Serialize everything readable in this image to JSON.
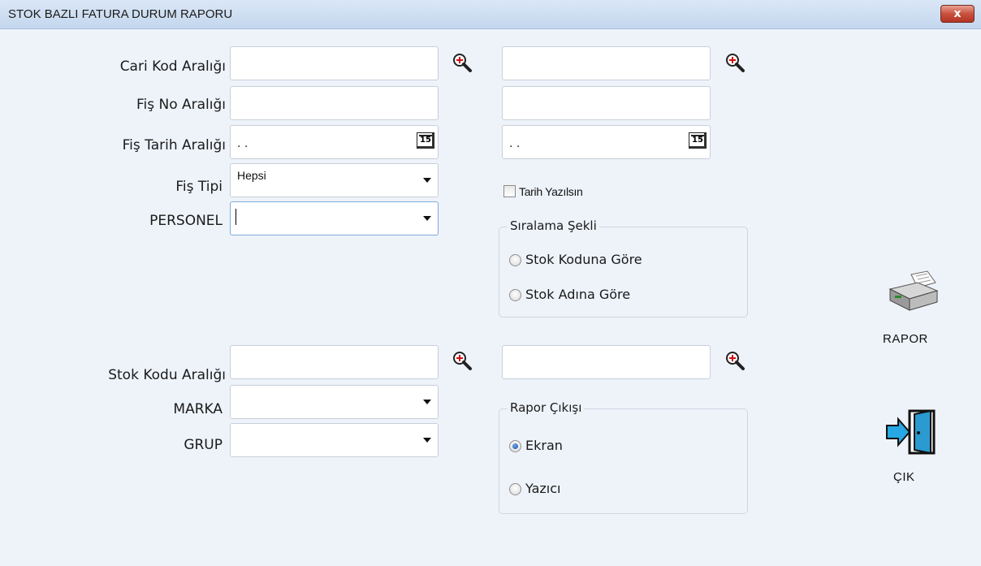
{
  "window": {
    "title": "STOK BAZLI FATURA DURUM RAPORU",
    "close_label": "x"
  },
  "form": {
    "cari_kod_label": "Cari Kod Aralığı",
    "fis_no_label": "Fiş No Aralığı",
    "fis_tarih_label": "Fiş Tarih Aralığı",
    "fis_tipi_label": "Fiş Tipi",
    "personel_label": "PERSONEL",
    "stok_kodu_label": "Stok Kodu Aralığı",
    "marka_label": "MARKA",
    "grup_label": "GRUP",
    "cari_kod_start": "",
    "cari_kod_end": "",
    "fis_no_start": "",
    "fis_no_end": "",
    "fis_tarih_start": ". .",
    "fis_tarih_end": ". .",
    "calendar_icon_text": "15",
    "fis_tipi_value": "Hepsi",
    "personel_value": "",
    "stok_kodu_start": "",
    "stok_kodu_end": "",
    "marka_value": "",
    "grup_value": ""
  },
  "options": {
    "tarih_yazilsin_label": "Tarih Yazılsın",
    "tarih_yazilsin_checked": false
  },
  "siralama": {
    "title": "Sıralama Şekli",
    "option_kod": "Stok Koduna Göre",
    "option_ad": "Stok Adına Göre",
    "selected": "none"
  },
  "rapor_cikisi": {
    "title": "Rapor Çıkışı",
    "option_ekran": "Ekran",
    "option_yazici": "Yazıcı",
    "selected": "Ekran"
  },
  "buttons": {
    "rapor_label": "RAPOR",
    "cik_label": "ÇIK"
  },
  "icons": {
    "search": "magnifier-plus-icon",
    "printer": "printer-icon",
    "exit": "exit-door-icon"
  },
  "colors": {
    "background": "#eef3fa",
    "titlebar": "#c4d7ee",
    "close": "#c8513f",
    "accent": "#1d4f9c"
  }
}
